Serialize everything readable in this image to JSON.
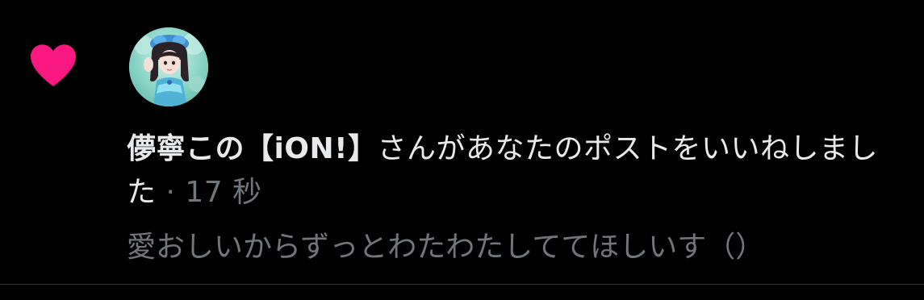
{
  "notification": {
    "icon": "heart-icon",
    "icon_color": "#f91880",
    "user_name": "儚寧この【iON!】",
    "action_text": "さんがあなたのポストをいいねしました",
    "separator": " · ",
    "timestamp": "17 秒",
    "post_preview": "愛おしいからずっとわたわたしててほしいす（）"
  },
  "colors": {
    "background": "#000000",
    "primary_text": "#e7e9ea",
    "secondary_text": "#71767b",
    "divider": "#2f3336"
  }
}
